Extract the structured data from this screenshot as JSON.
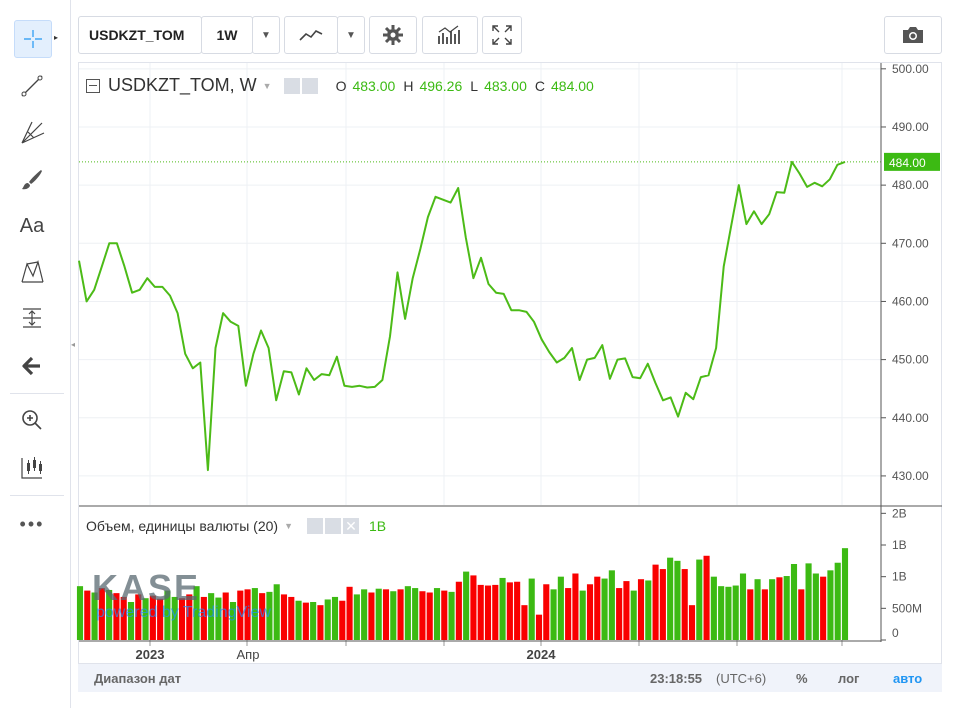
{
  "toolbar": {
    "symbol": "USDKZT_TOM",
    "interval": "1W"
  },
  "legend": {
    "title": "USDKZT_TOM, W",
    "o_label": "O",
    "o_value": "483.00",
    "h_label": "H",
    "h_value": "496.26",
    "l_label": "L",
    "l_value": "483.00",
    "c_label": "C",
    "c_value": "484.00"
  },
  "volume_legend": {
    "title": "Объем, единицы валюты (20)",
    "value": "1B"
  },
  "watermark": {
    "line1": "KASE",
    "line2": "powered by TradingView"
  },
  "bottom_bar": {
    "range_label": "Диапазон дат",
    "time": "23:18:55",
    "tz": "(UTC+6)",
    "percent": "%",
    "log": "лог",
    "auto": "авто"
  },
  "colors": {
    "line": "#4cbb17",
    "up": "#3cba13",
    "down": "#f90000",
    "accent": "#2196f3"
  },
  "chart_data": {
    "type": "line",
    "price_axis": {
      "ylim": [
        425,
        501
      ],
      "ticks": [
        500,
        490,
        480,
        470,
        460,
        450,
        440,
        430
      ]
    },
    "price_tick_labels": [
      "500.00",
      "490.00",
      "480.00",
      "470.00",
      "460.00",
      "450.00",
      "440.00",
      "430.00"
    ],
    "last_price": 484.0,
    "last_price_label": "484.00",
    "x_ticks": [
      "2023",
      "Апр",
      "2024"
    ],
    "series": [
      {
        "values": [
          467,
          460,
          462,
          466,
          470,
          470,
          466,
          461.5,
          462,
          464,
          462.5,
          462.5,
          461,
          458,
          451,
          448.5,
          449.5,
          431,
          452,
          458,
          456.5,
          455.8,
          445.5,
          451,
          455,
          452,
          443,
          448,
          447.8,
          444,
          448.5,
          446.5,
          447.5,
          447.3,
          450.5,
          445.5,
          445.3,
          445.5,
          445.2,
          445.3,
          446.5,
          454,
          465,
          457,
          464,
          469,
          474.5,
          478,
          477.5,
          477,
          479.5,
          471,
          464,
          467.5,
          463,
          461.5,
          461.3,
          458.5,
          458.5,
          458.2,
          456.5,
          453.5,
          451.3,
          449.5,
          450.3,
          452,
          446.5,
          450,
          450.3,
          452.5,
          446.7,
          450,
          450.2,
          447,
          446.8,
          449.3,
          446,
          443,
          443.5,
          440.2,
          444.3,
          443.2,
          447,
          447.3,
          452,
          466,
          473,
          480,
          473.3,
          475.5,
          473.3,
          475,
          478.8,
          478.7,
          484,
          482,
          479.7,
          480.4,
          479.8,
          481,
          483.5,
          484
        ]
      }
    ],
    "volume_axis": {
      "ylim": [
        0,
        2.1
      ],
      "ticks": [
        0,
        0.5,
        1,
        1.5,
        2
      ]
    },
    "volume_tick_labels": [
      "0",
      "500M",
      "1B",
      "1B",
      "2B"
    ],
    "volume": {
      "values": [
        0.85,
        0.78,
        0.75,
        0.82,
        0.79,
        0.74,
        0.68,
        0.6,
        0.72,
        0.66,
        0.7,
        0.65,
        0.78,
        0.68,
        0.66,
        0.72,
        0.85,
        0.68,
        0.74,
        0.67,
        0.75,
        0.6,
        0.78,
        0.8,
        0.82,
        0.74,
        0.76,
        0.88,
        0.72,
        0.68,
        0.62,
        0.59,
        0.6,
        0.55,
        0.64,
        0.68,
        0.62,
        0.84,
        0.72,
        0.8,
        0.75,
        0.81,
        0.8,
        0.77,
        0.8,
        0.85,
        0.82,
        0.77,
        0.75,
        0.82,
        0.78,
        0.76,
        0.92,
        1.08,
        1.02,
        0.87,
        0.86,
        0.87,
        0.98,
        0.91,
        0.92,
        0.55,
        0.97,
        0.4,
        0.88,
        0.8,
        1.0,
        0.82,
        1.05,
        0.78,
        0.88,
        1.0,
        0.97,
        1.1,
        0.82,
        0.93,
        0.78,
        0.96,
        0.94,
        1.19,
        1.12,
        1.3,
        1.25,
        1.12,
        0.55,
        1.27,
        1.33,
        1.0,
        0.85,
        0.84,
        0.86,
        1.05,
        0.8,
        0.96,
        0.8,
        0.96,
        0.99,
        1.01,
        1.2,
        0.8,
        1.21,
        1.05,
        1.0,
        1.1,
        1.22,
        1.45
      ],
      "up": [
        1,
        0,
        1,
        0,
        1,
        0,
        0,
        1,
        0,
        1,
        0,
        0,
        1,
        1,
        0,
        0,
        1,
        0,
        1,
        1,
        0,
        1,
        0,
        0,
        1,
        0,
        1,
        1,
        0,
        0,
        1,
        0,
        1,
        0,
        1,
        1,
        0,
        0,
        1,
        1,
        0,
        1,
        0,
        1,
        0,
        1,
        1,
        0,
        0,
        1,
        0,
        1,
        0,
        1,
        0,
        0,
        0,
        0,
        1,
        0,
        0,
        0,
        1,
        0,
        0,
        1,
        1,
        0,
        0,
        1,
        0,
        0,
        1,
        1,
        0,
        0,
        1,
        0,
        1,
        0,
        0,
        1,
        1,
        0,
        0,
        1,
        0,
        1,
        1,
        1,
        1,
        1,
        0,
        1,
        0,
        1,
        0,
        1,
        1,
        0,
        1,
        1,
        0,
        1,
        1,
        1
      ]
    }
  }
}
